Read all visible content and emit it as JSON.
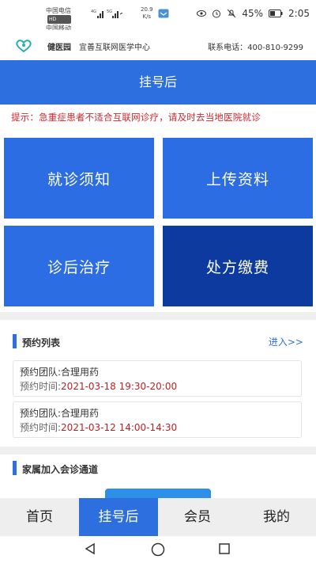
{
  "status_bar": {
    "carrier_1": "中国电信",
    "carrier_1_badge": "HD",
    "carrier_2": "中国移动",
    "net_type_1": "4G",
    "net_type_2": "5G",
    "speed_value": "20.9",
    "speed_unit": "K/s",
    "battery": "45%",
    "time": "2:05",
    "icons": [
      "eye-icon",
      "alarm-icon",
      "mute-icon",
      "battery-icon"
    ]
  },
  "brand": {
    "name": "健医园",
    "subtitle": "宜善互联网医学中心",
    "phone": "联系电话：400-810-9299"
  },
  "title": "挂号后",
  "notice": "提示：急重症患者不适合互联网诊疗，请及时去当地医院就诊",
  "tiles": [
    {
      "label": "就诊须知",
      "color": "#2c6de3"
    },
    {
      "label": "上传资料",
      "color": "#2c6de3"
    },
    {
      "label": "诊后治疗",
      "color": "#2c6de3"
    },
    {
      "label": "处方缴费",
      "color": "#0d3a9e"
    }
  ],
  "appointments_section": {
    "title": "预约列表",
    "link": "进入>>",
    "items": [
      {
        "team_label": "预约团队:合理用药",
        "time_label": "预约时间:",
        "time_value": "2021-03-18 19:30-20:00"
      },
      {
        "team_label": "预约团队:合理用药",
        "time_label": "预约时间:",
        "time_value": "2021-03-12 14:00-14:30"
      }
    ]
  },
  "family_section": {
    "title": "家属加入会诊通道"
  },
  "tabs": [
    {
      "label": "首页",
      "active": false
    },
    {
      "label": "挂号后",
      "active": true
    },
    {
      "label": "会员",
      "active": false
    },
    {
      "label": "我的",
      "active": false
    }
  ],
  "colors": {
    "primary": "#2e6fe0",
    "dark_tile": "#0d3a9e",
    "warning_text": "#d6262b",
    "time_text": "#c02020"
  }
}
